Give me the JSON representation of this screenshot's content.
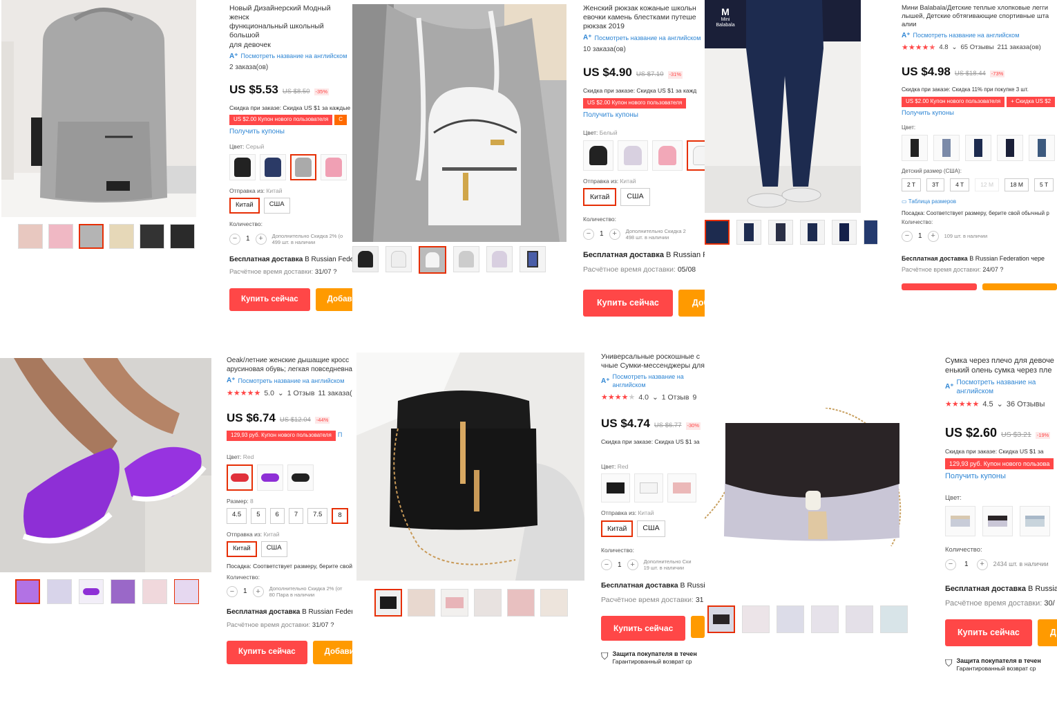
{
  "common": {
    "translate_label": "Посмотреть название на английском",
    "buy_now": "Купить сейчас",
    "add_to_cart": "Добави",
    "get_coupons": "Получить купоны",
    "ship_from_label": "Отправка из:",
    "ship_from_value": "Китай",
    "quantity_label": "Количество:",
    "free_shipping_bold": "Бесплатная доставка",
    "free_shipping_rest": "В Russian Federa",
    "delivery_est_label": "Расчётное время доставки:",
    "protection_title": "Защита покупателя в течен",
    "protection_sub": "Гарантированный возврат ср"
  },
  "products": [
    {
      "title": "Новый Дизайнерский Модный женск\nфункциональный школьный большой\nдля девочек",
      "orders": "2 заказа(ов)",
      "price": "US $5.53",
      "old_price": "US $8.50",
      "discount": "-35%",
      "order_discount": "Скидка при заказе: Скидка US $1 за каждые U",
      "coupons": [
        "US $2.00 Купон нового пользователя",
        "С"
      ],
      "color_label": "Цвет:",
      "color_value": "Серый",
      "ship_options": [
        "Китай",
        "США"
      ],
      "qty": "1",
      "qty_note_1": "Дополнительно Скидка 2% (о",
      "qty_note_2": "499 шт. в наличии",
      "delivery_date": "31/07",
      "shipping_rest": "В Russian Feder",
      "add_to_cart": "Добави"
    },
    {
      "title": "Женский рюкзак кожаные школьн\nевочки камень блестками путеше\nрюкзак 2019",
      "orders": "10 заказа(ов)",
      "price": "US $4.90",
      "old_price": "US $7.10",
      "discount": "-31%",
      "order_discount": "Скидка при заказе: Скидка US $1 за кажд",
      "coupons": [
        "US $2.00 Купон нового пользователя"
      ],
      "color_label": "Цвет:",
      "color_value": "Белый",
      "ship_options": [
        "Китай",
        "США"
      ],
      "qty": "1",
      "qty_note_1": "Дополнительно Скидка 2",
      "qty_note_2": "498 шт. в наличии",
      "delivery_date": "05/08",
      "shipping_rest": "В Russian F",
      "add_to_cart": "Доба"
    },
    {
      "title": "Мини Balabala/Детские теплые хлопковые легги\nлышей, Детские обтягивающие спортивные шта\nалии",
      "rating": "4.8",
      "reviews": "65 Отзывы",
      "orders": "211 заказа(ов)",
      "price": "US $4.98",
      "old_price": "US $18.44",
      "discount": "-73%",
      "order_discount": "Скидка при заказе: Скидка 11% при покупке 3 шт.",
      "coupons": [
        "US $2.00 Купон нового пользователя",
        "+ Скидка US $2"
      ],
      "color_label": "Цвет:",
      "size_label": "Детский размер (США):",
      "sizes": [
        "2 T",
        "3T",
        "4 T",
        "12 M",
        "18 M",
        "5 T"
      ],
      "size_table": "Таблица размеров",
      "fit": "Посадка: Соответствует размеру, берите свой обычный р",
      "qty": "1",
      "qty_note_1": "109 шт. в наличии",
      "delivery_date": "24/07",
      "shipping_rest": "В Russian Federation чере",
      "logo": "Mini Balabala"
    },
    {
      "title": "Oeak/летние женские дышащие кросс\nарусиновая обувь; легкая повседневна",
      "rating": "5.0",
      "reviews": "1 Отзыв",
      "orders": "11 заказа(",
      "price": "US $6.74",
      "old_price": "US $12.04",
      "discount": "-44%",
      "coupons": [
        "129,93 руб. Купон нового пользователя",
        "П"
      ],
      "color_label": "Цвет:",
      "color_value": "Red",
      "size_label": "Размер:",
      "size_value": "8",
      "sizes": [
        "4.5",
        "5",
        "6",
        "7",
        "7.5",
        "8"
      ],
      "ship_options": [
        "Китай",
        "США"
      ],
      "fit": "Посадка: Соответствует размеру, берите свой",
      "qty": "1",
      "qty_note_1": "Дополнительно Скидка 2% (от",
      "qty_note_2": "80 Пара в наличии",
      "delivery_date": "31/07",
      "shipping_rest": "В Russian Federa",
      "add_to_cart": "Добавит"
    },
    {
      "title": "Универсальные роскошные с\nчные Сумки-мессенджеры для",
      "rating": "4.0",
      "reviews": "1 Отзыв",
      "orders": "9",
      "price": "US $4.74",
      "old_price": "US $6.77",
      "discount": "-30%",
      "order_discount": "Скидка при заказе: Скидка US $1 за",
      "color_label": "Цвет:",
      "color_value": "Red",
      "ship_options": [
        "Китай",
        "США"
      ],
      "qty": "1",
      "qty_note_1": "Дополнительно Ски",
      "qty_note_2": "19 шт. в наличии",
      "delivery_date": "31",
      "shipping_rest": "В Russi",
      "protection_title": "Защита покупателя в течен",
      "protection_sub": "Гарантированный возврат ср"
    },
    {
      "title": "Сумка через плечо для девоче\nенький олень сумка через пле",
      "rating": "4.5",
      "reviews": "36 Отзывы",
      "price": "US $2.60",
      "old_price": "US $3.21",
      "discount": "-19%",
      "order_discount": "Скидка при заказе: Скидка US $1 за",
      "coupons": [
        "129,93 руб. Купон нового пользова"
      ],
      "color_label": "Цвет:",
      "qty": "1",
      "qty_note_1": "2434 шт. в наличии",
      "delivery_date": "30/",
      "shipping_rest": "В Russia",
      "add_to_cart": "Д",
      "protection_title": "Защита покупателя в течен",
      "protection_sub": "Гарантированный возврат ср"
    }
  ]
}
